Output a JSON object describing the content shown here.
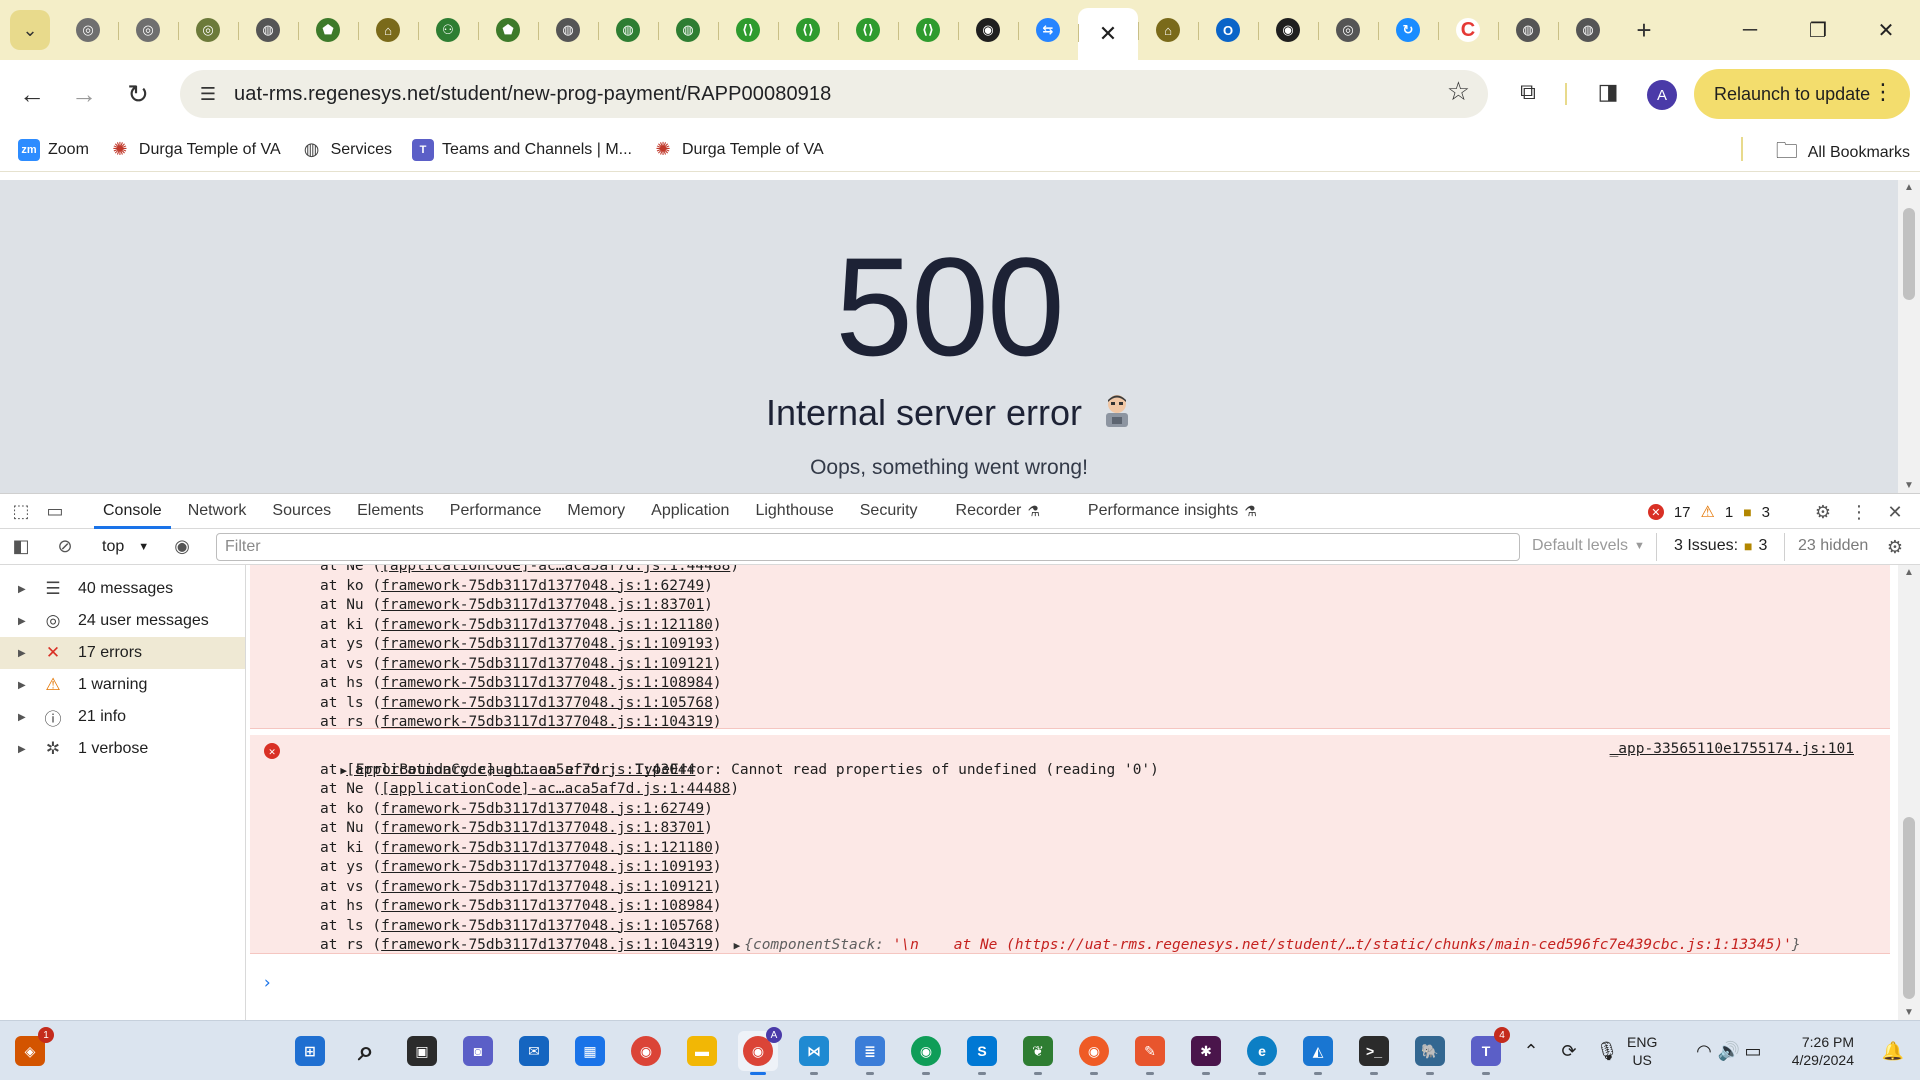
{
  "colors": {
    "accent": "#1a73e8",
    "error": "#d93025",
    "warning": "#e37400",
    "page_bg": "#dde1e6",
    "relaunch": "#f3dd6d"
  },
  "browser": {
    "tabs": [
      {
        "icon": "regenesys-icon"
      },
      {
        "icon": "regenesys-icon"
      },
      {
        "icon": "regenesys-green-icon"
      },
      {
        "icon": "globe-icon"
      },
      {
        "icon": "regenesys-shield-icon"
      },
      {
        "icon": "landmark-icon"
      },
      {
        "icon": "user-settings-icon"
      },
      {
        "icon": "regenesys-shield-icon"
      },
      {
        "icon": "globe-icon"
      },
      {
        "icon": "green-globe-icon"
      },
      {
        "icon": "green-globe-icon"
      },
      {
        "icon": "green-code-icon"
      },
      {
        "icon": "green-code-icon"
      },
      {
        "icon": "green-code-icon"
      },
      {
        "icon": "green-code-icon"
      },
      {
        "icon": "github-icon"
      },
      {
        "icon": "jira-icon"
      },
      {
        "icon": "close-icon",
        "active": true
      },
      {
        "icon": "landmark-icon"
      },
      {
        "icon": "outlook-icon"
      },
      {
        "icon": "github-icon"
      },
      {
        "icon": "github-outline-icon"
      },
      {
        "icon": "refresh-blue-icon"
      },
      {
        "icon": "c-red-icon"
      },
      {
        "icon": "globe-icon"
      },
      {
        "icon": "globe-icon"
      }
    ],
    "new_tab_label": "+",
    "url": "uat-rms.regenesys.net/student/new-prog-payment/RAPP00080918",
    "profile_initial": "A",
    "relaunch_label": "Relaunch to update",
    "bookmarks": [
      {
        "label": "Zoom",
        "icon": "zoom-icon",
        "color": "#2d8cff",
        "glyph": "zm"
      },
      {
        "label": "Durga Temple of VA",
        "icon": "temple-icon",
        "color": "#c0392b",
        "glyph": "✺"
      },
      {
        "label": "Services",
        "icon": "globe-icon",
        "color": "#444444",
        "glyph": "◍"
      },
      {
        "label": "Teams and Channels | M...",
        "icon": "teams-icon",
        "color": "#5b5fc7",
        "glyph": "T"
      },
      {
        "label": "Durga Temple of VA",
        "icon": "temple-icon",
        "color": "#c0392b",
        "glyph": "✺"
      }
    ],
    "all_bookmarks_label": "All Bookmarks"
  },
  "page": {
    "code": "500",
    "title": "Internal server error",
    "message": "Oops, something went wrong!"
  },
  "devtools": {
    "tabs": [
      "Console",
      "Network",
      "Sources",
      "Elements",
      "Performance",
      "Memory",
      "Application",
      "Lighthouse",
      "Security",
      "Recorder",
      "Performance insights"
    ],
    "active_tab": "Console",
    "counts": {
      "errors": "17",
      "warnings": "1",
      "messages": "3"
    },
    "context": "top",
    "filter_placeholder": "Filter",
    "levels_label": "Default levels",
    "issues_label": "3 Issues:",
    "issues_count": "3",
    "hidden_label": "23 hidden",
    "sidebar": [
      {
        "label": "40 messages",
        "icon": "list-icon"
      },
      {
        "label": "24 user messages",
        "icon": "user-icon"
      },
      {
        "label": "17 errors",
        "icon": "error-icon",
        "selected": true
      },
      {
        "label": "1 warning",
        "icon": "warning-icon"
      },
      {
        "label": "21 info",
        "icon": "info-icon"
      },
      {
        "label": "1 verbose",
        "icon": "bug-icon"
      }
    ],
    "trace1": [
      {
        "fn": "Ne",
        "src": "[applicationCode]-ac…aca5af7d.js:1:44488"
      },
      {
        "fn": "ko",
        "src": "framework-75db3117d1377048.js:1:62749"
      },
      {
        "fn": "Nu",
        "src": "framework-75db3117d1377048.js:1:83701"
      },
      {
        "fn": "ki",
        "src": "framework-75db3117d1377048.js:1:121180"
      },
      {
        "fn": "ys",
        "src": "framework-75db3117d1377048.js:1:109193"
      },
      {
        "fn": "vs",
        "src": "framework-75db3117d1377048.js:1:109121"
      },
      {
        "fn": "hs",
        "src": "framework-75db3117d1377048.js:1:108984"
      },
      {
        "fn": "ls",
        "src": "framework-75db3117d1377048.js:1:105768"
      },
      {
        "fn": "rs",
        "src": "framework-75db3117d1377048.js:1:104319"
      }
    ],
    "error2": {
      "message": "ErrorBoundary caught an error:  TypeError: Cannot read properties of undefined (reading '0')",
      "source": "_app-33565110e1755174.js:101",
      "first_frame": "[applicationCode]-ac…aca5af7d.js:1:43044",
      "object_preview_key": "{componentStack: ",
      "object_preview_val": "'\\n    at Ne (https://uat-rms.regenesys.net/student/…t/static/chunks/main-ced596fc7e439cbc.js:1:13345)'",
      "object_preview_end": "}"
    },
    "trace2": [
      {
        "fn": "Ne",
        "src": "[applicationCode]-ac…aca5af7d.js:1:44488"
      },
      {
        "fn": "ko",
        "src": "framework-75db3117d1377048.js:1:62749"
      },
      {
        "fn": "Nu",
        "src": "framework-75db3117d1377048.js:1:83701"
      },
      {
        "fn": "ki",
        "src": "framework-75db3117d1377048.js:1:121180"
      },
      {
        "fn": "ys",
        "src": "framework-75db3117d1377048.js:1:109193"
      },
      {
        "fn": "vs",
        "src": "framework-75db3117d1377048.js:1:109121"
      },
      {
        "fn": "hs",
        "src": "framework-75db3117d1377048.js:1:108984"
      },
      {
        "fn": "ls",
        "src": "framework-75db3117d1377048.js:1:105768"
      },
      {
        "fn": "rs",
        "src": "framework-75db3117d1377048.js:1:104319"
      }
    ],
    "prompt_symbol": "›"
  },
  "taskbar": {
    "apps": [
      {
        "icon": "notification-app-icon",
        "badge": "1"
      },
      {
        "icon": "windows-start-icon"
      },
      {
        "icon": "search-icon"
      },
      {
        "icon": "task-view-icon"
      },
      {
        "icon": "teams-chat-icon"
      },
      {
        "icon": "mail-icon"
      },
      {
        "icon": "store-icon"
      },
      {
        "icon": "chrome-icon"
      },
      {
        "icon": "file-explorer-icon"
      },
      {
        "icon": "chrome-profile-icon",
        "badge": "A"
      },
      {
        "icon": "vscode-icon"
      },
      {
        "icon": "notepad-icon"
      },
      {
        "icon": "chrome-alt-icon"
      },
      {
        "icon": "skype-icon"
      },
      {
        "icon": "mongodb-icon"
      },
      {
        "icon": "postman-icon"
      },
      {
        "icon": "pen-app-icon"
      },
      {
        "icon": "slack-icon"
      },
      {
        "icon": "edge-icon"
      },
      {
        "icon": "paint-icon"
      },
      {
        "icon": "terminal-icon"
      },
      {
        "icon": "postgres-icon"
      },
      {
        "icon": "teams-new-icon",
        "badge": "4"
      }
    ],
    "lang_top": "ENG",
    "lang_bottom": "US",
    "time": "7:26 PM",
    "date": "4/29/2024"
  }
}
